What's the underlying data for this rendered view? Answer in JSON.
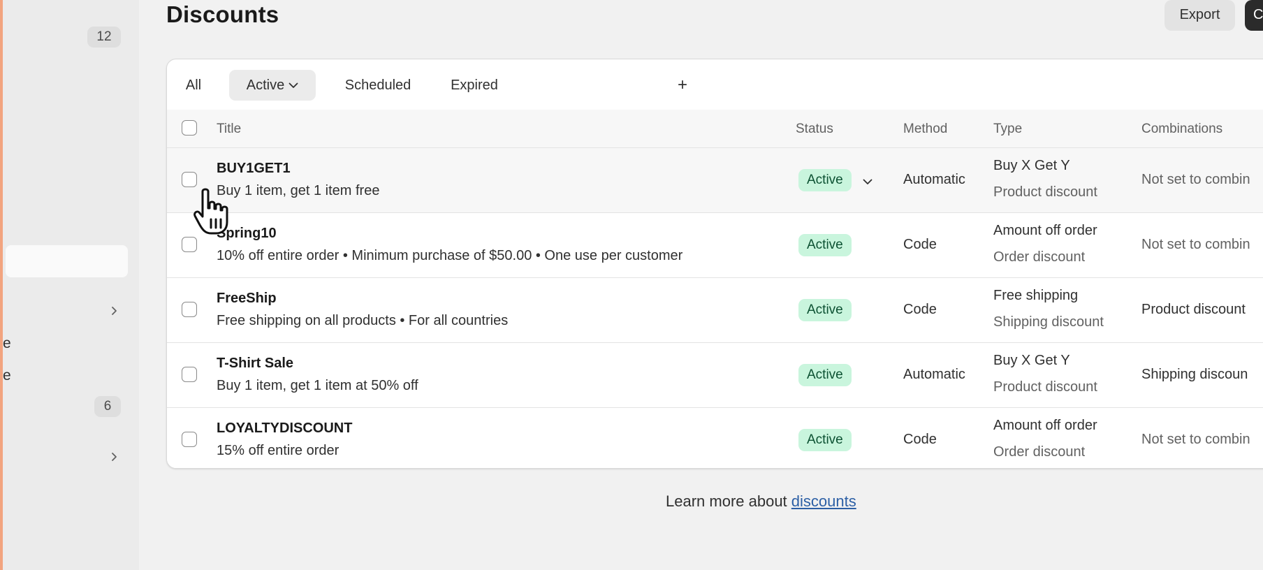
{
  "sidebar": {
    "badge_top": "12",
    "badge_bottom": "6",
    "fragment_1": "e",
    "fragment_2": "e"
  },
  "header": {
    "title": "Discounts",
    "export_label": "Export",
    "primary_label": "C"
  },
  "tabs": [
    {
      "label": "All",
      "selected": false
    },
    {
      "label": "Active",
      "selected": true,
      "has_dropdown": true
    },
    {
      "label": "Scheduled",
      "selected": false
    },
    {
      "label": "Expired",
      "selected": false
    },
    {
      "label": "+",
      "selected": false
    }
  ],
  "table": {
    "columns": [
      "Title",
      "Status",
      "Method",
      "Type",
      "Combinations"
    ],
    "rows": [
      {
        "title": "BUY1GET1",
        "description": "Buy 1 item, get 1 item free",
        "status": "Active",
        "method": "Automatic",
        "type": "Buy X Get Y",
        "type_detail": "Product discount",
        "combinations": "Not set to combin"
      },
      {
        "title": "Spring10",
        "description": "10% off entire order • Minimum purchase of $50.00 • One use per customer",
        "status": "Active",
        "method": "Code",
        "type": "Amount off order",
        "type_detail": "Order discount",
        "combinations": "Not set to combin"
      },
      {
        "title": "FreeShip",
        "description": "Free shipping on all products • For all countries",
        "status": "Active",
        "method": "Code",
        "type": "Free shipping",
        "type_detail": "Shipping discount",
        "combinations": "Product discount"
      },
      {
        "title": "T-Shirt Sale",
        "description": "Buy 1 item, get 1 item at 50% off",
        "status": "Active",
        "method": "Automatic",
        "type": "Buy X Get Y",
        "type_detail": "Product discount",
        "combinations": "Shipping discoun"
      },
      {
        "title": "LOYALTYDISCOUNT",
        "description": "15% off entire order",
        "status": "Active",
        "method": "Code",
        "type": "Amount off order",
        "type_detail": "Order discount",
        "combinations": "Not set to combin"
      }
    ]
  },
  "footer": {
    "learn_prefix": "Learn more about ",
    "learn_link": "discounts"
  },
  "colors": {
    "accent_strip": "#f2a47f",
    "badge_bg": "#c9f5dd",
    "badge_text": "#0c5132",
    "link": "#2c5fa5"
  },
  "icons": {
    "tab_dropdown": "chevron-down-icon",
    "row_status_dropdown": "chevron-down-icon",
    "sidebar_expand": "chevron-right-icon",
    "cursor": "hand-pointer-icon"
  }
}
